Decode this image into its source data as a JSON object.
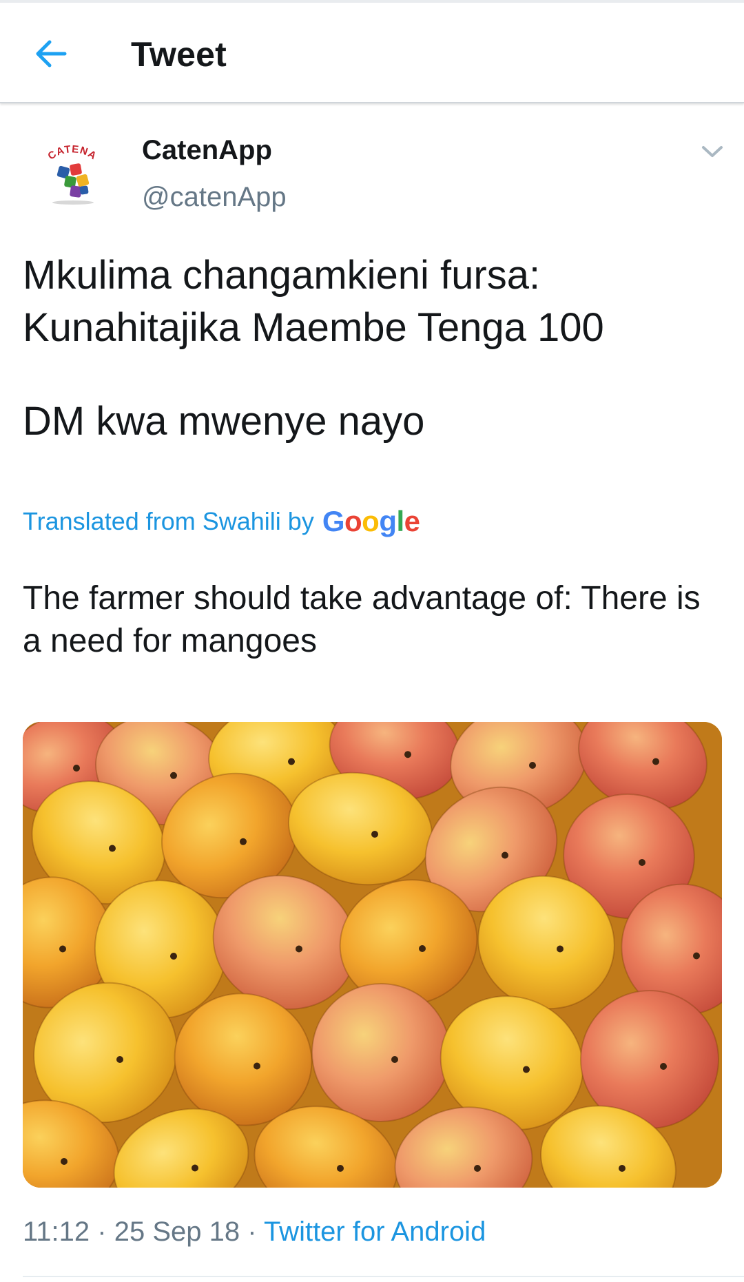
{
  "header": {
    "title": "Tweet",
    "back_icon": "arrow-left-icon",
    "accent": "#1da1f2"
  },
  "author": {
    "name": "CatenApp",
    "handle": "@catenApp",
    "avatar_text": "CATENA",
    "menu_icon": "chevron-down-icon"
  },
  "tweet": {
    "lines": [
      "Mkulima changamkieni fursa:",
      "Kunahitajika Maembe Tenga 100",
      "",
      "DM kwa mwenye nayo"
    ],
    "translated_label": "Translated from Swahili by",
    "translated_provider": "Google",
    "translation": "The farmer should take advantage of: There is a need for mangoes"
  },
  "media": {
    "icon": "photo-of-mangoes"
  },
  "meta": {
    "time": "11:12",
    "separator": "·",
    "date": "25 Sep 18",
    "source": "Twitter for Android"
  },
  "colors": {
    "link": "#1b95e0",
    "secondary_text": "#657786",
    "primary_text": "#14171a",
    "google_blue": "#4285f4",
    "google_red": "#ea4335",
    "google_yellow": "#fbbc05",
    "google_green": "#34a853"
  }
}
